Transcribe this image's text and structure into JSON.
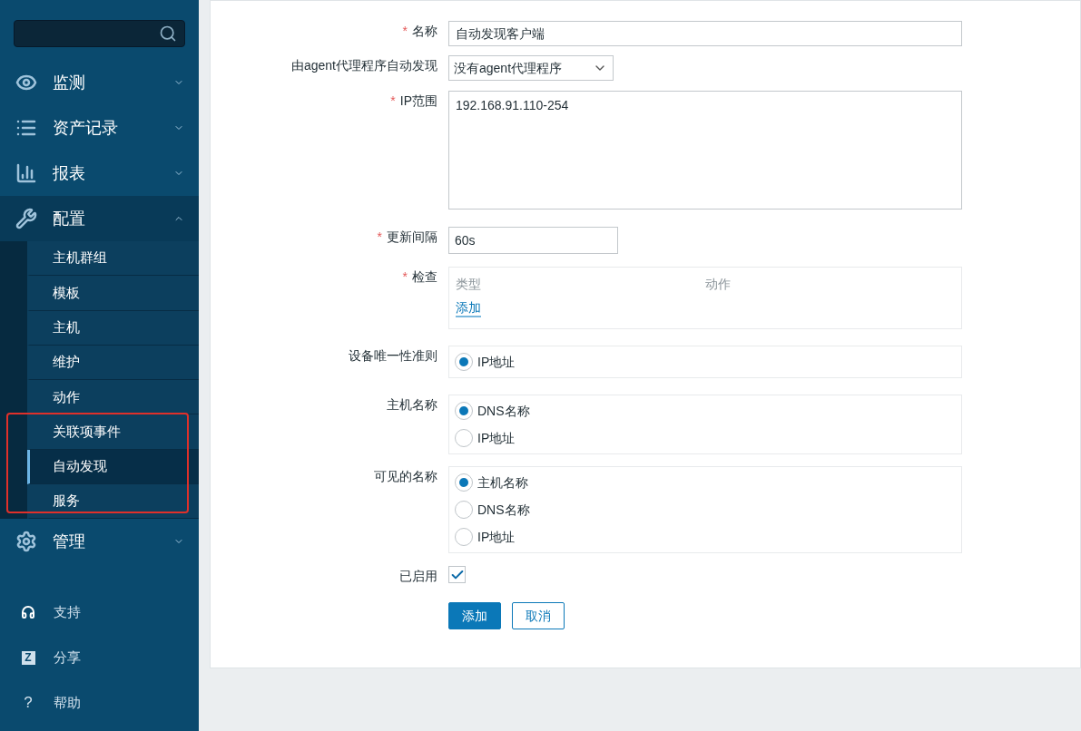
{
  "sidebar": {
    "menu": [
      {
        "label": "监测",
        "kind": "eye",
        "expanded": false
      },
      {
        "label": "资产记录",
        "kind": "list",
        "expanded": false
      },
      {
        "label": "报表",
        "kind": "chart",
        "expanded": false
      },
      {
        "label": "配置",
        "kind": "wrench",
        "expanded": true,
        "children": [
          {
            "label": "主机群组",
            "selected": false
          },
          {
            "label": "模板",
            "selected": false
          },
          {
            "label": "主机",
            "selected": false
          },
          {
            "label": "维护",
            "selected": false
          },
          {
            "label": "动作",
            "selected": false
          },
          {
            "label": "关联项事件",
            "selected": false
          },
          {
            "label": "自动发现",
            "selected": true
          },
          {
            "label": "服务",
            "selected": false
          }
        ]
      },
      {
        "label": "管理",
        "kind": "gear",
        "expanded": false
      }
    ],
    "footer": [
      {
        "label": "支持",
        "kind": "headset"
      },
      {
        "label": "分享",
        "kind": "letter",
        "glyph": "Z"
      },
      {
        "label": "帮助",
        "kind": "glyph",
        "glyph": "?"
      }
    ]
  },
  "form": {
    "fields": [
      {
        "kind": "text",
        "label": "名称",
        "required_mark": "*",
        "value": "自动发现客户端"
      },
      {
        "kind": "select",
        "label": "由agent代理程序自动发现",
        "value": "没有agent代理程序"
      },
      {
        "kind": "textarea",
        "label": "IP范围",
        "required_mark": "*",
        "value": "192.168.91.110-254"
      },
      {
        "kind": "short",
        "label": "更新间隔",
        "required_mark": "*",
        "value": "60s"
      },
      {
        "kind": "checks",
        "label": "检查",
        "required_mark": "*",
        "columns": [
          "类型",
          "动作"
        ],
        "link": "添加"
      },
      {
        "kind": "radio",
        "label": "设备唯一性准则",
        "options": [
          {
            "label": "IP地址",
            "selected": true
          }
        ]
      },
      {
        "kind": "radio",
        "label": "主机名称",
        "options": [
          {
            "label": "DNS名称",
            "selected": true
          },
          {
            "label": "IP地址",
            "selected": false
          }
        ]
      },
      {
        "kind": "radio",
        "label": "可见的名称",
        "options": [
          {
            "label": "主机名称",
            "selected": true
          },
          {
            "label": "DNS名称",
            "selected": false
          },
          {
            "label": "IP地址",
            "selected": false
          }
        ]
      },
      {
        "kind": "checkbox",
        "label": "已启用",
        "checked": true
      }
    ],
    "buttons": [
      {
        "label": "添加",
        "kind": "primary"
      },
      {
        "label": "取消",
        "kind": "secondary"
      }
    ]
  }
}
